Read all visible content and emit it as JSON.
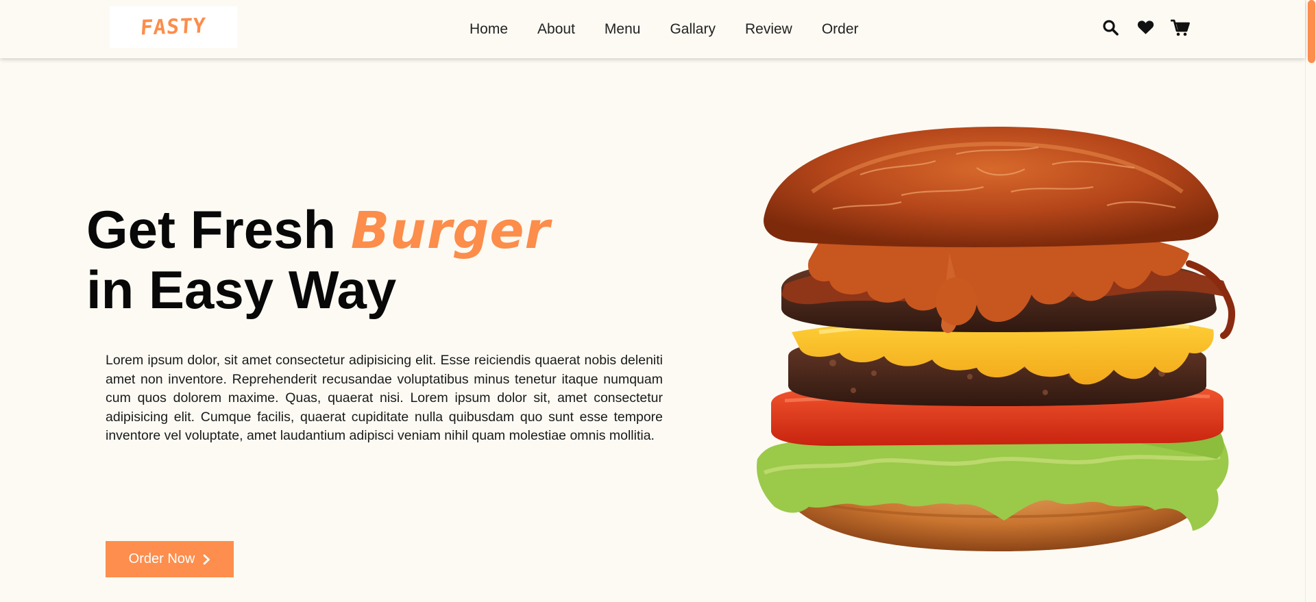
{
  "header": {
    "logo": "FASTY",
    "nav": [
      "Home",
      "About",
      "Menu",
      "Gallary",
      "Review",
      "Order"
    ],
    "icons": [
      "search-icon",
      "heart-icon",
      "cart-icon"
    ]
  },
  "hero": {
    "title_part1": "Get Fresh ",
    "title_accent": "Burger",
    "title_line2": "in Easy Way",
    "description": "Lorem ipsum dolor, sit amet consectetur adipisicing elit. Esse reiciendis quaerat nobis deleniti amet non inventore. Reprehenderit recusandae voluptatibus minus tenetur itaque numquam cum quos dolorem maxime. Quas, quaerat nisi. Lorem ipsum dolor sit, amet consectetur adipisicing elit. Cumque facilis, quaerat cupiditate nulla quibusdam quo sunt esse tempore inventore vel voluptate, amet laudantium adipisci veniam nihil quam molestiae omnis mollitia.",
    "cta_label": "Order Now"
  },
  "colors": {
    "accent": "#fd8e4d",
    "background": "#fcfaf3",
    "text": "#111111"
  }
}
